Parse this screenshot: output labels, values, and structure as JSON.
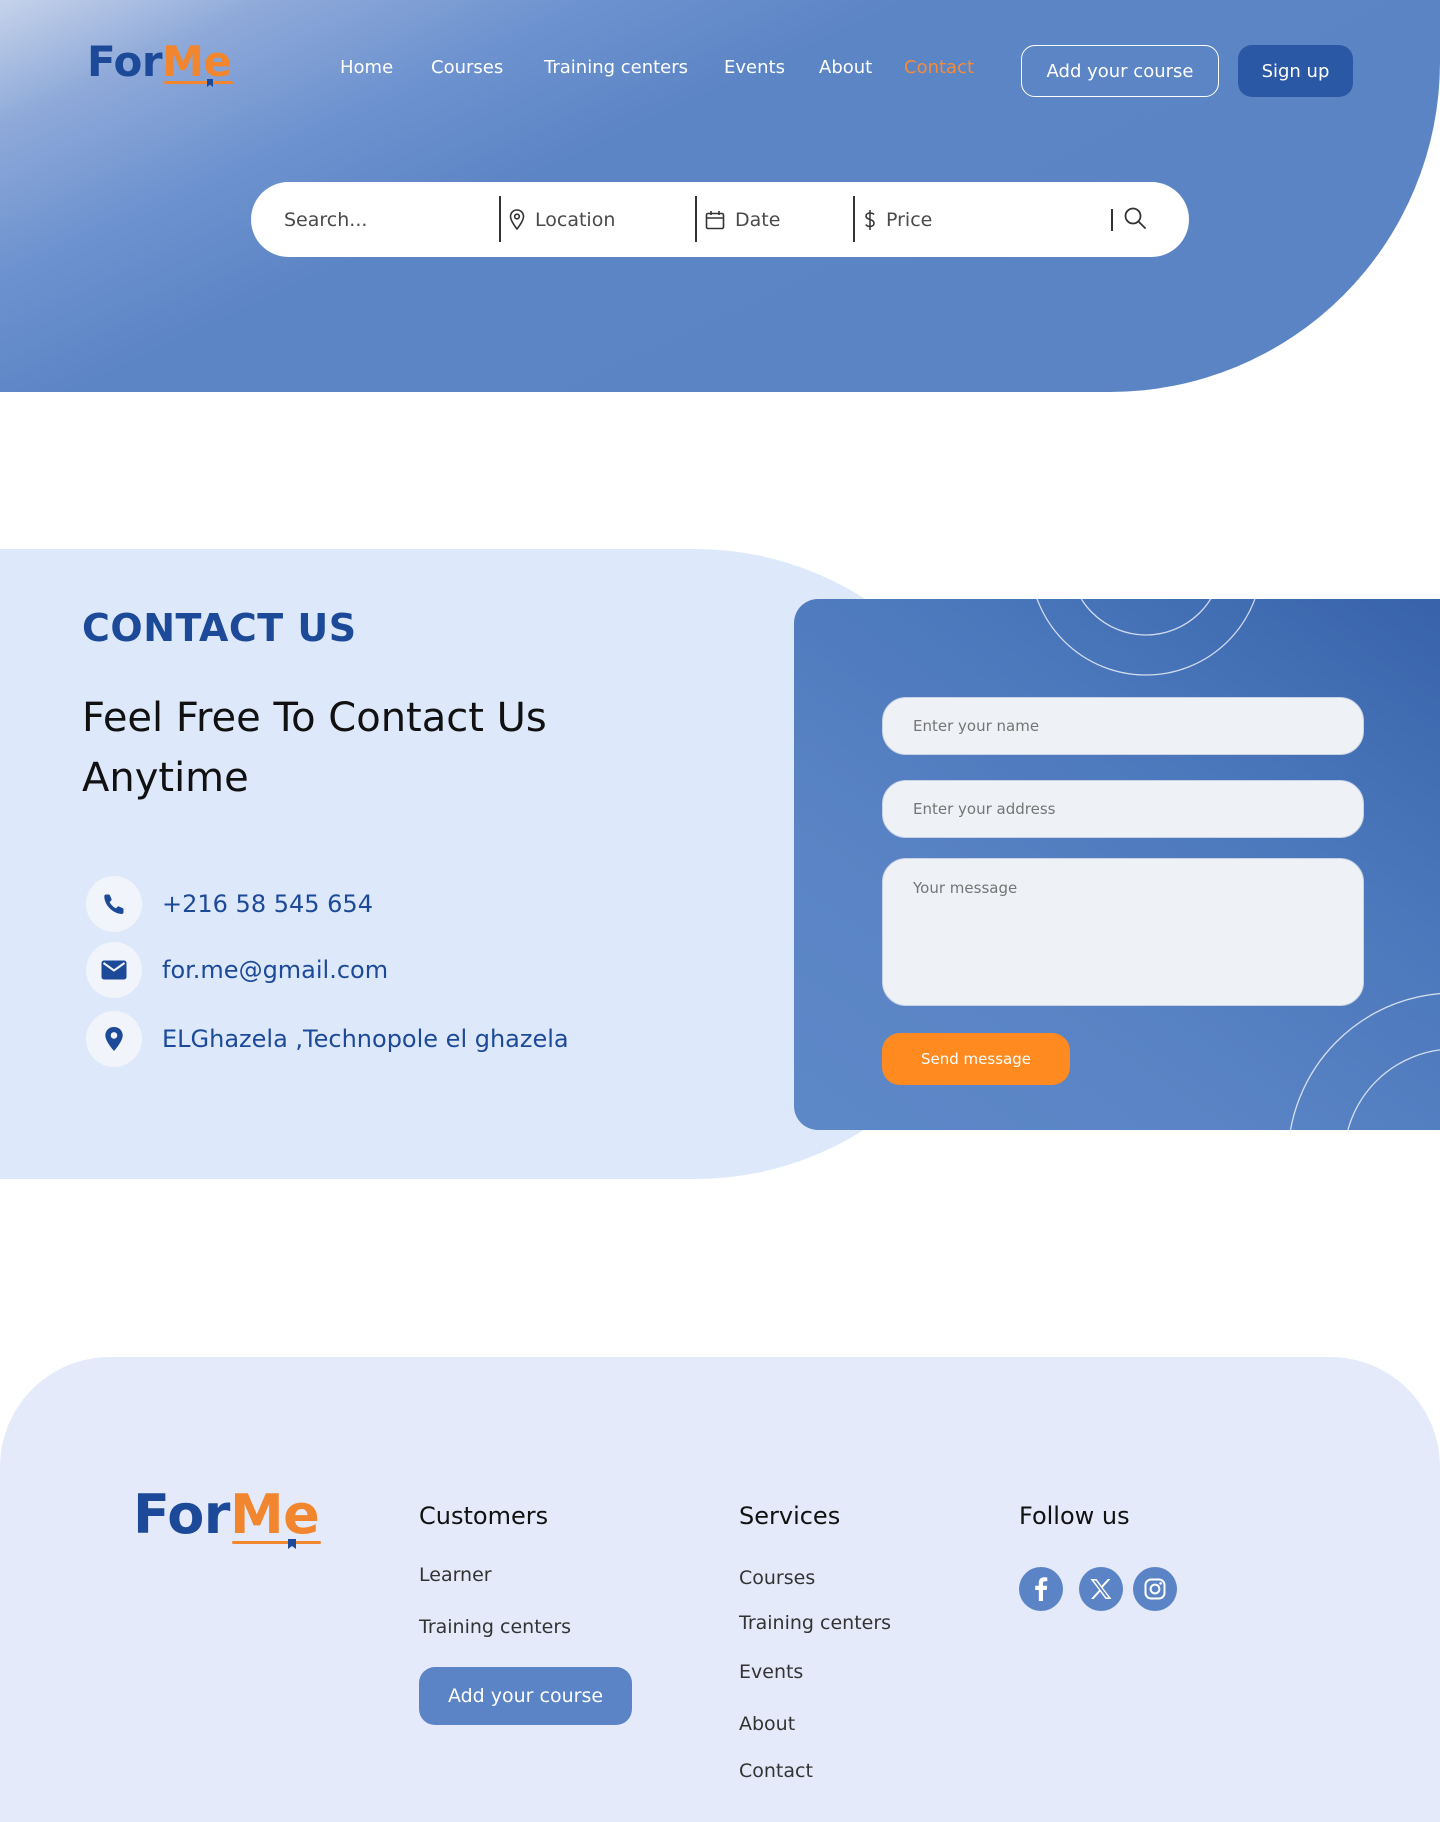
{
  "brand": {
    "for": "For",
    "me": "Me"
  },
  "nav": {
    "items": [
      "Home",
      "Courses",
      "Training centers",
      "Events",
      "About",
      "Contact"
    ],
    "active": "Contact"
  },
  "header": {
    "add_course_label": "Add your course",
    "signup_label": "Sign up"
  },
  "search": {
    "search_placeholder": "Search...",
    "location_label": "Location",
    "date_label": "Date",
    "price_label": "Price"
  },
  "contact": {
    "title": "CONTACT US",
    "subtitle": "Feel Free To Contact Us Anytime",
    "phone": "+216 58 545 654",
    "email": "for.me@gmail.com",
    "address": "ELGhazela ,Technopole el ghazela"
  },
  "form": {
    "name_placeholder": "Enter your name",
    "address_placeholder": "Enter your address",
    "message_placeholder": "Your message",
    "send_label": "Send message"
  },
  "footer": {
    "customers": {
      "heading": "Customers",
      "links": [
        "Learner",
        "Training centers"
      ],
      "button": "Add your course"
    },
    "services": {
      "heading": "Services",
      "links": [
        "Courses",
        "Training centers",
        "Events",
        "About",
        "Contact"
      ]
    },
    "follow": {
      "heading": "Follow us",
      "icons": [
        "facebook-icon",
        "x-icon",
        "instagram-icon"
      ]
    }
  },
  "colors": {
    "primary": "#5a84c4",
    "dark_blue": "#1d4a98",
    "accent": "#f2862e",
    "contact_bg": "#dde9fb",
    "footer_bg": "#e4eafa"
  }
}
